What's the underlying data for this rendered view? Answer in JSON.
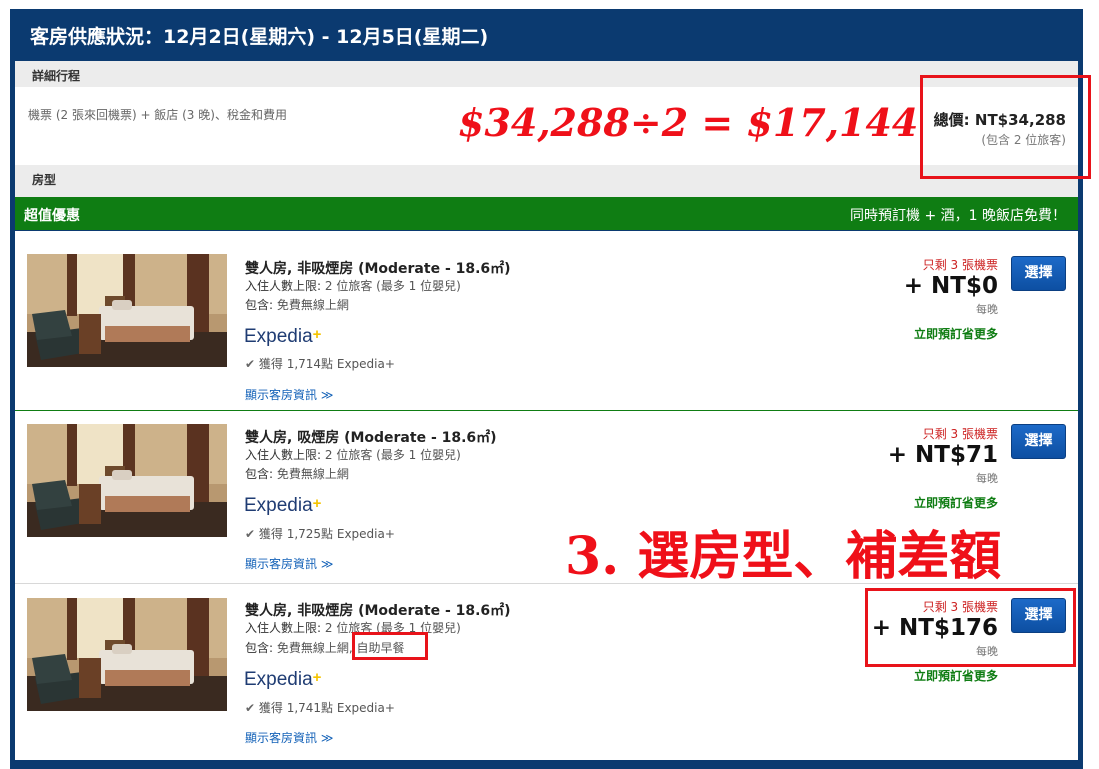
{
  "header": {
    "title": "客房供應狀況：12月2日(星期六) - 12月5日(星期二)"
  },
  "details": {
    "section_label": "詳細行程",
    "summary": "機票 (2 張來回機票) + 飯店 (3 晚)、稅金和費用",
    "total_label": "總價: NT$34,288",
    "total_note": "(包含 2 位旅客)"
  },
  "room_section_label": "房型",
  "deal": {
    "title": "超值優惠",
    "promo": "同時預訂機 + 酒，1 晚飯店免費！"
  },
  "annotations": {
    "calc": "$34,288÷2 = $17,144",
    "step": "3. 選房型、補差額"
  },
  "rooms": [
    {
      "name": "雙人房, 非吸煙房 (Moderate - 18.6㎡)",
      "occupancy_label": "入住人數上限:",
      "occupancy": "2 位旅客 (最多 1 位嬰兒)",
      "includes_label": "包含:",
      "includes": "免費無線上網",
      "breakfast": "",
      "brand": "Expedia",
      "brand_plus": "+",
      "points": "獲得 1,714點 Expedia+",
      "more_info": "顯示客房資訊 ≫",
      "seats_left": "只剩 3 張機票",
      "price": "+ NT$0",
      "per_night": "每晚",
      "save_more": "立即預訂省更多",
      "select": "選擇"
    },
    {
      "name": "雙人房, 吸煙房 (Moderate - 18.6㎡)",
      "occupancy_label": "入住人數上限:",
      "occupancy": "2 位旅客 (最多 1 位嬰兒)",
      "includes_label": "包含:",
      "includes": "免費無線上網",
      "breakfast": "",
      "brand": "Expedia",
      "brand_plus": "+",
      "points": "獲得 1,725點 Expedia+",
      "more_info": "顯示客房資訊 ≫",
      "seats_left": "只剩 3 張機票",
      "price": "+ NT$71",
      "per_night": "每晚",
      "save_more": "立即預訂省更多",
      "select": "選擇"
    },
    {
      "name": "雙人房, 非吸煙房 (Moderate - 18.6㎡)",
      "occupancy_label": "入住人數上限:",
      "occupancy": "2 位旅客 (最多 1 位嬰兒)",
      "includes_label": "包含:",
      "includes": "免費無線上網",
      "breakfast": ", 自助早餐",
      "brand": "Expedia",
      "brand_plus": "+",
      "points": "獲得 1,741點 Expedia+",
      "more_info": "顯示客房資訊 ≫",
      "seats_left": "只剩 3 張機票",
      "price": "+ NT$176",
      "per_night": "每晚",
      "save_more": "立即預訂省更多",
      "select": "選擇"
    }
  ],
  "colors": {
    "header": "#0b3a70",
    "deal": "#0f7d13",
    "annotation": "#ef1019",
    "button": "#1d6ac8"
  }
}
